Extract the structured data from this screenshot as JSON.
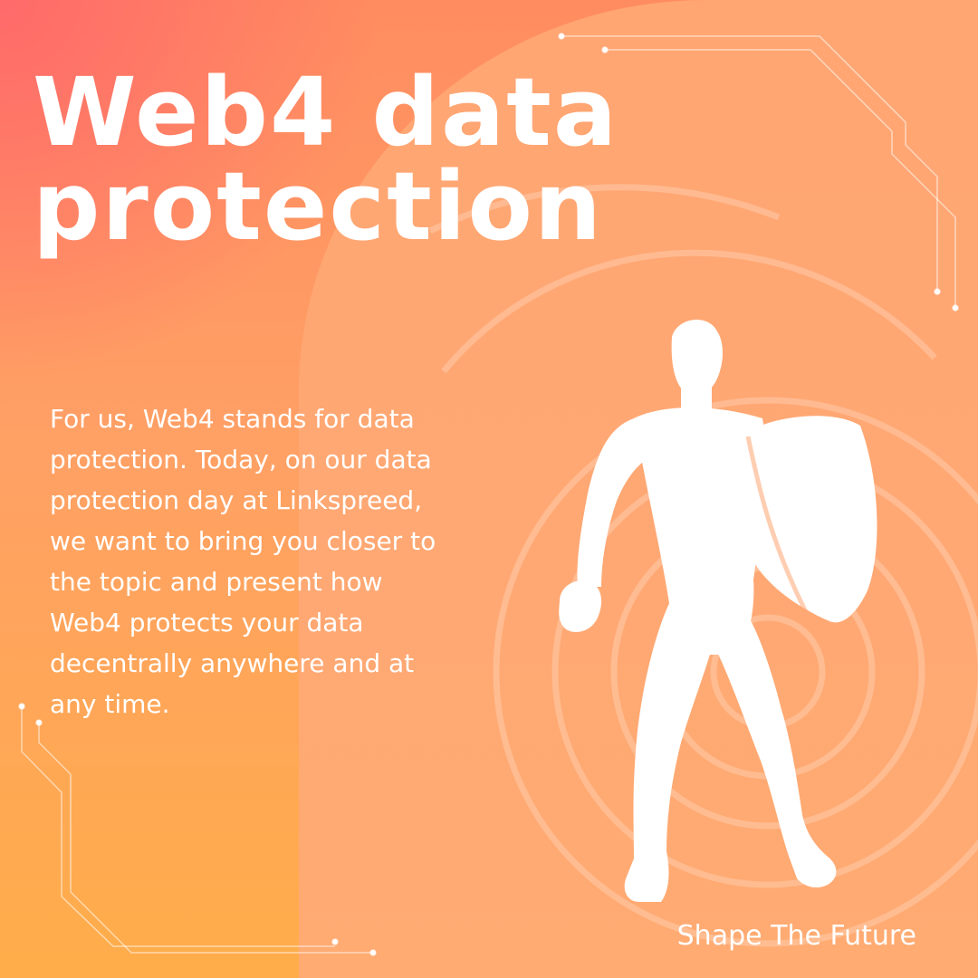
{
  "headline": {
    "line1": "Web4 data",
    "line2": "protection"
  },
  "body": "For us, Web4 stands for data protection. Today, on our data protection day at Linkspreed, we want to bring you closer to the topic and present how Web4 protects your data decentrally anywhere and at any time.",
  "footer": {
    "slogan": "Shape The Future"
  },
  "colors": {
    "text": "#ffffff",
    "background_top": "#ff6a6a",
    "background_main": "#ffa673",
    "background_bottom": "#ffad4a"
  },
  "illustration": {
    "figure": "hero-with-shield-silhouette",
    "rings": "concentric-circles",
    "lines": "circuit-lines"
  }
}
